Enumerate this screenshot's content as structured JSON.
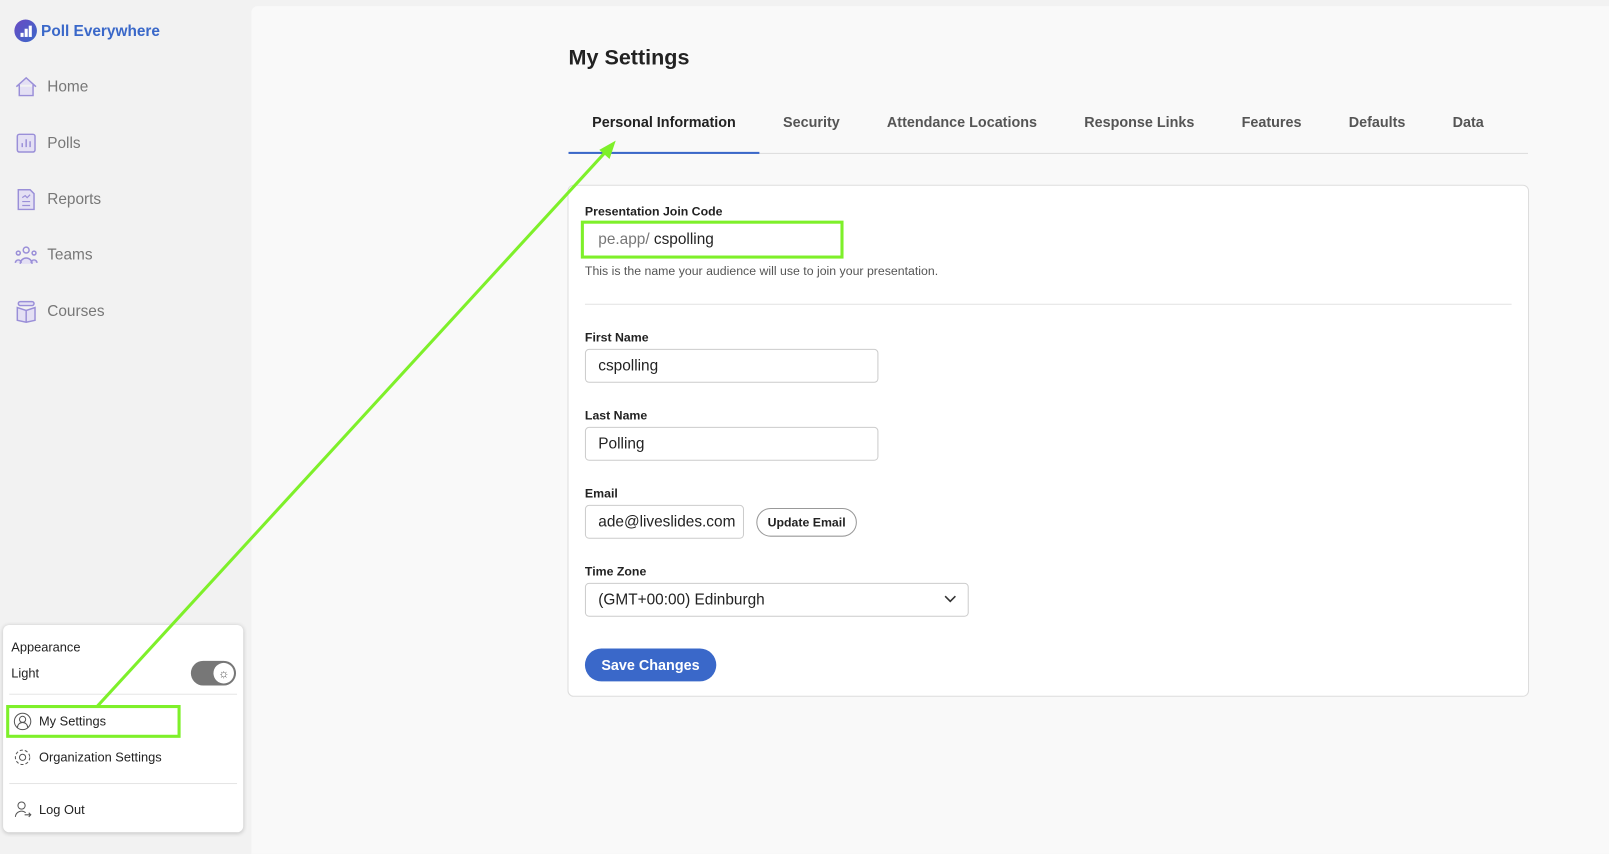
{
  "brand": "Poll Everywhere",
  "nav": [
    {
      "label": "Home"
    },
    {
      "label": "Polls"
    },
    {
      "label": "Reports"
    },
    {
      "label": "Teams"
    },
    {
      "label": "Courses"
    }
  ],
  "page_title": "My Settings",
  "tabs": [
    "Personal Information",
    "Security",
    "Attendance Locations",
    "Response Links",
    "Features",
    "Defaults",
    "Data"
  ],
  "form": {
    "join_code_label": "Presentation Join Code",
    "join_prefix": "pe.app/",
    "join_code": "cspolling",
    "join_help": "This is the name your audience will use to join your presentation.",
    "first_name_label": "First Name",
    "first_name": "cspolling",
    "last_name_label": "Last Name",
    "last_name": "Polling",
    "email_label": "Email",
    "email": "ade@liveslides.com",
    "update_email": "Update Email",
    "tz_label": "Time Zone",
    "tz": "(GMT+00:00) Edinburgh",
    "save": "Save Changes"
  },
  "menu": {
    "appearance": "Appearance",
    "mode": "Light",
    "my_settings": "My Settings",
    "org_settings": "Organization Settings",
    "logout": "Log Out"
  },
  "colors": {
    "accent": "#3a68c9",
    "highlight": "#7ef02a"
  }
}
